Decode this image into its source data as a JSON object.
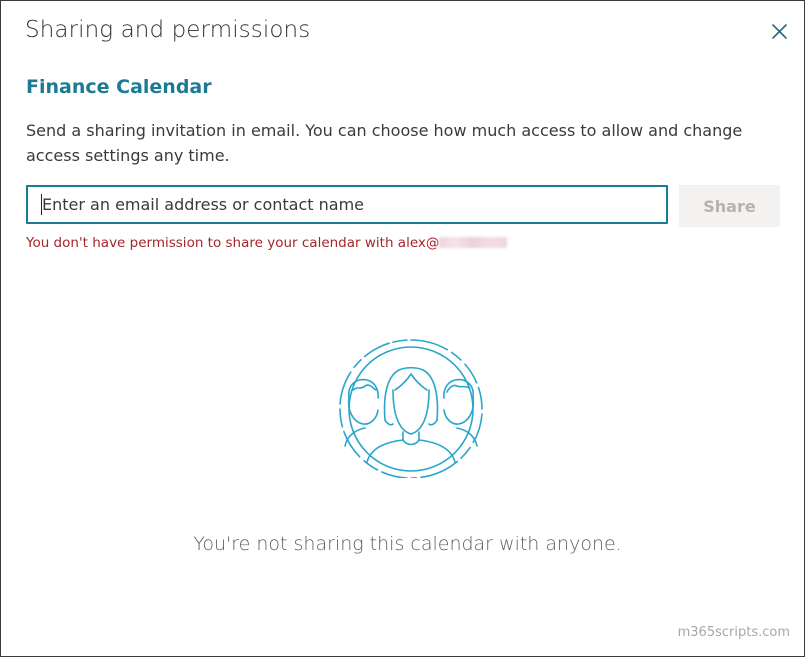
{
  "dialog": {
    "title": "Sharing and permissions",
    "close_icon": "close-icon"
  },
  "calendar": {
    "name": "Finance Calendar"
  },
  "description": "Send a sharing invitation in email. You can choose how much access to allow and change access settings any time.",
  "invite": {
    "placeholder": "Enter an email address or contact name",
    "value": "",
    "share_label": "Share",
    "share_enabled": false
  },
  "error": {
    "message": "You don't have permission to share your calendar with alex@"
  },
  "empty_state": {
    "illustration_icon": "people-sharing-icon",
    "message": "You're not sharing this calendar with anyone."
  },
  "watermark": "m365scripts.com",
  "colors": {
    "accent": "#1c7a94",
    "error": "#a4262c",
    "illustration": "#29a6c9"
  }
}
